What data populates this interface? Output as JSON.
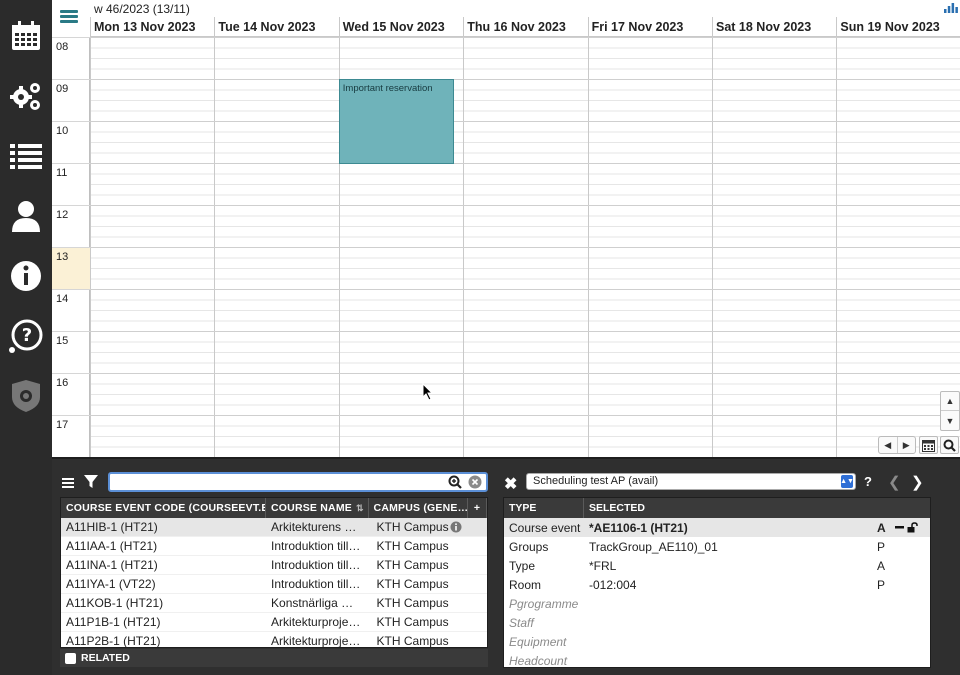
{
  "calendar": {
    "week_label": "w 46/2023 (13/11)",
    "days": [
      "Mon 13 Nov 2023",
      "Tue 14 Nov 2023",
      "Wed 15 Nov 2023",
      "Thu 16 Nov 2023",
      "Fri 17 Nov 2023",
      "Sat 18 Nov 2023",
      "Sun 19 Nov 2023"
    ],
    "hours": [
      "08",
      "09",
      "10",
      "11",
      "12",
      "13",
      "14",
      "15",
      "16",
      "17"
    ],
    "current_hour": "13",
    "event": {
      "title": "Important reservation",
      "day": "Wed 15 Nov 2023",
      "start": "09:00",
      "end": "11:00",
      "color": "#6fb3ba"
    }
  },
  "sidebar": {
    "items": [
      "calendar-icon",
      "gears-icon",
      "list-icon",
      "user-icon",
      "info-icon",
      "help-icon",
      "admin-shield-icon"
    ]
  },
  "search": {
    "value": "",
    "placeholder": ""
  },
  "course_table": {
    "columns": [
      "COURSE EVENT CODE (COURSEEVT.E…",
      "COURSE NAME",
      "CAMPUS (GENE…",
      "+"
    ],
    "rows": [
      {
        "code": "A11HIB-1 (HT21)",
        "name": "Arkitekturens …",
        "campus": "KTH Campus",
        "selected": true
      },
      {
        "code": "A11IAA-1 (HT21)",
        "name": "Introduktion till…",
        "campus": "KTH Campus"
      },
      {
        "code": "A11INA-1 (HT21)",
        "name": "Introduktion till…",
        "campus": "KTH Campus"
      },
      {
        "code": "A11IYA-1 (VT22)",
        "name": "Introduktion till…",
        "campus": "KTH Campus"
      },
      {
        "code": "A11KOB-1 (HT21)",
        "name": "Konstnärliga …",
        "campus": "KTH Campus"
      },
      {
        "code": "A11P1B-1 (HT21)",
        "name": "Arkitekturproje…",
        "campus": "KTH Campus"
      },
      {
        "code": "A11P2B-1 (HT21)",
        "name": "Arkitekturproje…",
        "campus": "KTH Campus"
      }
    ],
    "related_label": "RELATED"
  },
  "detail": {
    "schedule_name": "Scheduling test AP (avail)",
    "help": "?",
    "columns": [
      "TYPE",
      "SELECTED"
    ],
    "rows": [
      {
        "type": "Course event",
        "selected": "*AE1106-1 (HT21)",
        "flag": "A",
        "bold": true,
        "highlight": true
      },
      {
        "type": "Groups",
        "selected": "TrackGroup_AE110)_01",
        "flag": "P"
      },
      {
        "type": "Type",
        "selected": "*FRL",
        "flag": "A"
      },
      {
        "type": "Room",
        "selected": "-012:004",
        "flag": "P"
      },
      {
        "type": "Pgrogramme",
        "selected": "",
        "flag": "",
        "empty": true
      },
      {
        "type": "Staff",
        "selected": "",
        "flag": "",
        "empty": true
      },
      {
        "type": "Equipment",
        "selected": "",
        "flag": "",
        "empty": true
      },
      {
        "type": "Headcount",
        "selected": "",
        "flag": "",
        "empty": true
      }
    ]
  },
  "colors": {
    "accent": "#2a7a86",
    "event": "#6fb3ba",
    "sidebar": "#2b2b2b",
    "panel": "#2f2f2f"
  }
}
